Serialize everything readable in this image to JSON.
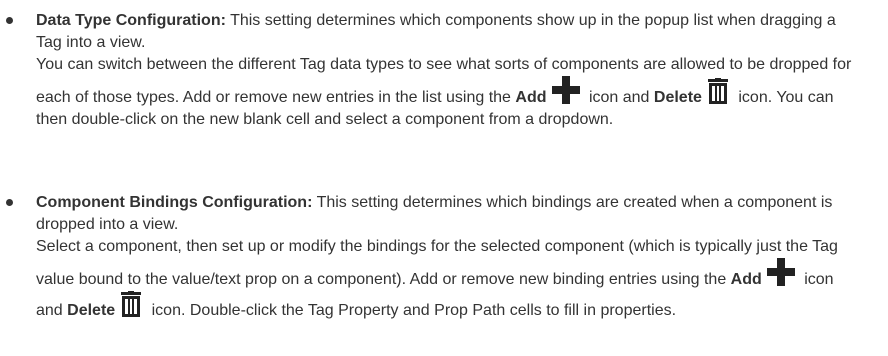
{
  "items": [
    {
      "title": "Data Type Configuration:",
      "intro": " This setting determines which components show up in the popup list when dragging a Tag into a view.",
      "body_start": "You can switch between the different Tag data types to see what sorts of components are allowed to be dropped for each of those types. Add or remove new entries in the list using the ",
      "add_label": "Add",
      "between": " icon and ",
      "delete_label": "Delete",
      "body_end": " icon. You can then double-click on the new blank cell and select a component from a dropdown."
    },
    {
      "title": "Component Bindings Configuration:",
      "intro": " This setting determines which bindings are created when a component is dropped into a view.",
      "body_start": "Select a component, then set up or modify the bindings for the selected component (which is typically just the Tag value bound to the value/text prop on a component). Add or remove new binding entries using the ",
      "add_label": "Add",
      "between": " icon and ",
      "delete_label": "Delete",
      "body_end": " icon. Double-click the Tag Property and Prop Path cells to fill in properties."
    }
  ],
  "icons": {
    "add": "plus-icon",
    "delete": "trash-icon"
  }
}
